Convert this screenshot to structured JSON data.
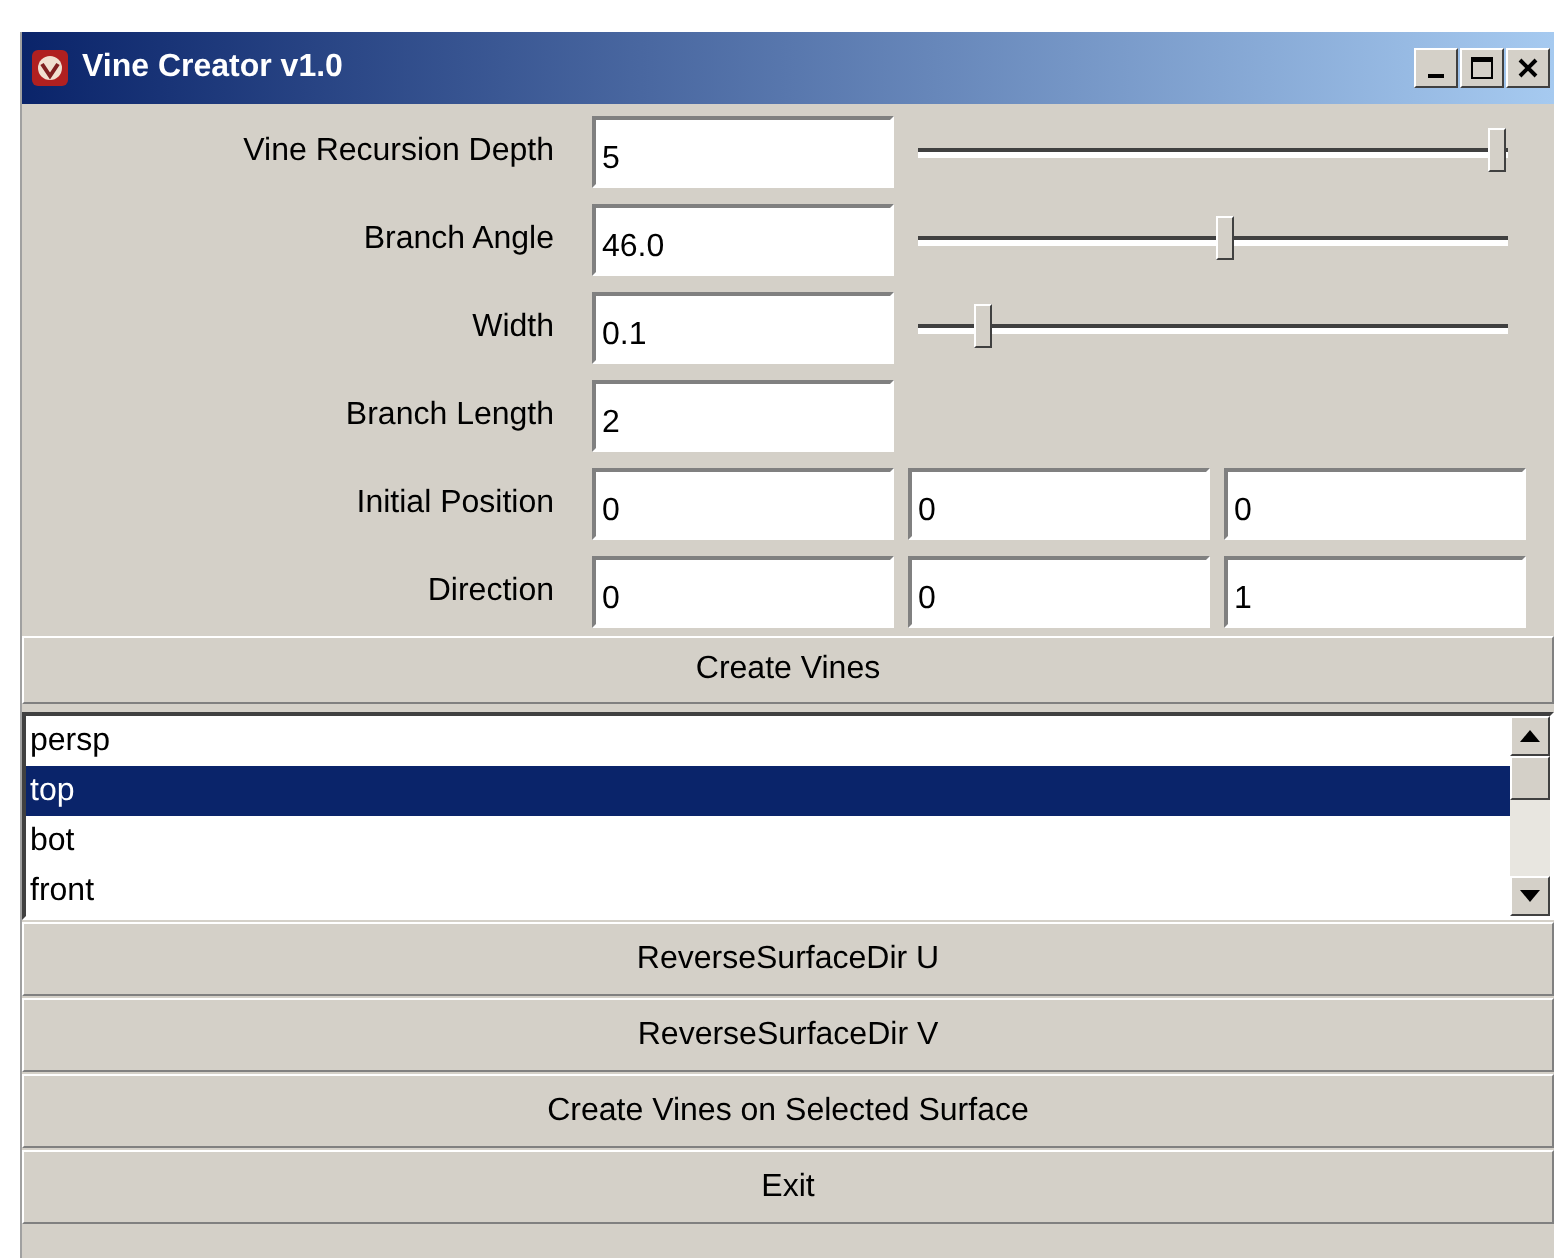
{
  "window": {
    "title": "Vine Creator v1.0"
  },
  "fields": [
    {
      "label": "Vine Recursion Depth",
      "values": [
        "5"
      ],
      "slider": {
        "level": 0.98
      }
    },
    {
      "label": "Branch Angle",
      "values": [
        "46.0"
      ],
      "slider": {
        "level": 0.52
      }
    },
    {
      "label": "Width",
      "values": [
        "0.1"
      ],
      "slider": {
        "level": 0.11
      }
    },
    {
      "label": "Branch Length",
      "values": [
        "2"
      ]
    },
    {
      "label": "Initial Position",
      "values": [
        "0",
        "0",
        "0"
      ]
    },
    {
      "label": "Direction",
      "values": [
        "0",
        "0",
        "1"
      ]
    }
  ],
  "create_button": "Create Vines",
  "list": [
    {
      "label": "persp",
      "selected": false
    },
    {
      "label": "top",
      "selected": true
    },
    {
      "label": "bot",
      "selected": false
    },
    {
      "label": "front",
      "selected": false
    }
  ],
  "buttons": [
    "ReverseSurfaceDir U",
    "ReverseSurfaceDir V",
    "Create Vines on Selected Surface",
    "Exit"
  ]
}
